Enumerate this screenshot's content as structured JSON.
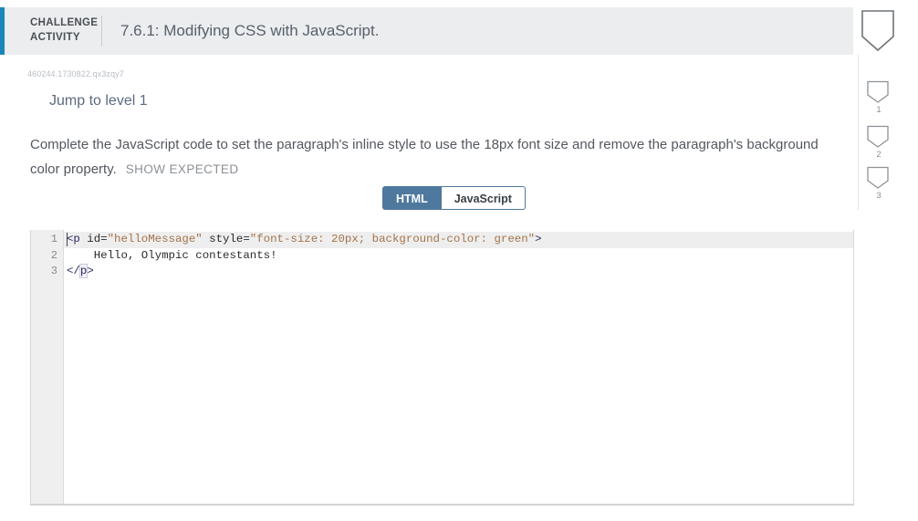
{
  "header": {
    "challenge_label_line1": "CHALLENGE",
    "challenge_label_line2": "ACTIVITY",
    "title": "7.6.1: Modifying CSS with JavaScript.",
    "accent_color": "#1b86b8",
    "background_color": "#ebedef",
    "shield_icon": "shield-outline-icon"
  },
  "body": {
    "activity_id": "460244.1730822.qx3zqy7",
    "jump_link": "Jump to level 1",
    "instruction_text": "Complete the JavaScript code to set the paragraph's inline style to use the 18px font size and remove the paragraph's background color property.",
    "show_expected_label": "SHOW EXPECTED"
  },
  "tabs": [
    {
      "label": "HTML",
      "active": true
    },
    {
      "label": "JavaScript",
      "active": false
    }
  ],
  "editor": {
    "active_line": 1,
    "gutter_numbers": [
      "1",
      "2",
      "3"
    ],
    "lines": [
      {
        "number": "1",
        "raw": "<p id=\"helloMessage\" style=\"font-size: 20px; background-color: green\">",
        "tokens": [
          {
            "text": "<p",
            "type": "tag"
          },
          {
            "text": " id=",
            "type": "attr"
          },
          {
            "text": "\"helloMessage\"",
            "type": "str"
          },
          {
            "text": " style=",
            "type": "attr"
          },
          {
            "text": "\"font-size: 20px; background-color: green\"",
            "type": "str"
          },
          {
            "text": ">",
            "type": "tag"
          }
        ]
      },
      {
        "number": "2",
        "raw": "    Hello, Olympic contestants!",
        "tokens": [
          {
            "text": "    Hello, Olympic contestants!",
            "type": "plain"
          }
        ]
      },
      {
        "number": "3",
        "raw": "</p>",
        "tokens": [
          {
            "text": "</",
            "type": "tag"
          },
          {
            "text": "p",
            "type": "tag-match"
          },
          {
            "text": ">",
            "type": "tag"
          }
        ]
      }
    ]
  },
  "right_rail": [
    {
      "number": "1",
      "icon": "shield-outline-icon"
    },
    {
      "number": "2",
      "icon": "shield-outline-icon"
    },
    {
      "number": "3",
      "icon": "shield-outline-icon"
    }
  ],
  "colors": {
    "accent_blue": "#1b86b8",
    "tab_active_blue": "#4e789e",
    "header_gray": "#ebedef",
    "gutter_gray": "#efefef",
    "string_token": "#a3744b",
    "tag_token": "#2a2a66"
  }
}
